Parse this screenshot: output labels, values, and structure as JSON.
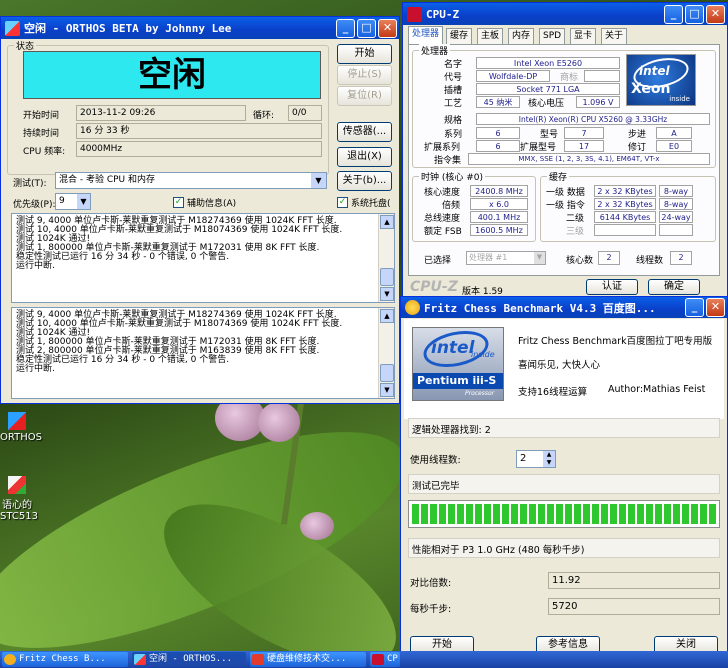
{
  "orthos": {
    "title": "空闲 - ORTHOS BETA by Johnny Lee",
    "status_group": "状态",
    "status_text": "空闲",
    "start_time_label": "开始时间",
    "start_time": "2013-11-2 09:26",
    "loop_label": "循环:",
    "loop": "0/0",
    "duration_label": "持续时间",
    "duration": "16 分 33 秒",
    "cpu_freq_label": "CPU 频率:",
    "cpu_freq": "4000MHz",
    "test_label": "测试(T):",
    "test_value": "混合 - 考验 CPU 和内存",
    "priority_label": "优先级(P):",
    "priority_value": "9",
    "aux_info": "辅助信息(A)",
    "systray": "系统托盘(",
    "buttons": {
      "start": "开始",
      "stop": "停止(S)",
      "reset": "复位(R)",
      "sensors": "传感器(...",
      "exit": "退出(X)",
      "about": "关于(b)..."
    },
    "log1": [
      "测试 9, 4000 单位卢卡斯-莱默重复测试于 M18274369 使用 1024K FFT 长度.",
      "测试 10, 4000 单位卢卡斯-莱默重复测试于 M18074369 使用 1024K FFT 长度.",
      "测试 1024K 通过!",
      "测试 1, 800000 单位卢卡斯-莱默重复测试于 M172031 使用 8K FFT 长度.",
      "稳定性测试已运行 16 分 34 秒 - 0 个错误, 0 个警告.",
      "运行中断."
    ],
    "log2": [
      "测试 9, 4000 单位卢卡斯-莱默重复测试于 M18274369 使用 1024K FFT 长度.",
      "测试 10, 4000 单位卢卡斯-莱默重复测试于 M18074369 使用 1024K FFT 长度.",
      "测试 1024K 通过!",
      "测试 1, 800000 单位卢卡斯-莱默重复测试于 M172031 使用 8K FFT 长度.",
      "测试 2, 800000 单位卢卡斯-莱默重复测试于 M163839 使用 8K FFT 长度.",
      "稳定性测试已运行 16 分 34 秒 - 0 个错误, 0 个警告.",
      "运行中断."
    ]
  },
  "cpuz": {
    "title": "CPU-Z",
    "tabs": [
      "处理器",
      "缓存",
      "主板",
      "内存",
      "SPD",
      "显卡",
      "关于"
    ],
    "processor_group": "处理器",
    "name_label": "名字",
    "name": "Intel Xeon E5260",
    "codename_label": "代号",
    "codename": "Wolfdale-DP",
    "brand_label": "商标",
    "package_label": "插槽",
    "package": "Socket 771 LGA",
    "tech_label": "工艺",
    "tech": "45 纳米",
    "voltage_label": "核心电压",
    "voltage": "1.096 V",
    "spec_label": "规格",
    "spec": "Intel(R) Xeon(R) CPU        X5260  @ 3.33GHz",
    "family_label": "系列",
    "family": "6",
    "model_label": "型号",
    "model": "7",
    "stepping_label": "步进",
    "stepping": "A",
    "ext_family_label": "扩展系列",
    "ext_family": "6",
    "ext_model_label": "扩展型号",
    "ext_model": "17",
    "revision_label": "修订",
    "revision": "E0",
    "instructions_label": "指令集",
    "instructions": "MMX, SSE (1, 2, 3, 3S, 4.1), EM64T, VT-x",
    "clocks_group": "时钟 (核心 #0)",
    "core_speed_label": "核心速度",
    "core_speed": "2400.8 MHz",
    "multiplier_label": "倍频",
    "multiplier": "x 6.0",
    "bus_speed_label": "总线速度",
    "bus_speed": "400.1 MHz",
    "rated_fsb_label": "额定 FSB",
    "rated_fsb": "1600.5 MHz",
    "cache_group": "缓存",
    "l1d_label": "一级 数据",
    "l1d": "2 x 32 KBytes",
    "l1d_way": "8-way",
    "l1i_label": "一级 指令",
    "l1i": "2 x 32 KBytes",
    "l1i_way": "8-way",
    "l2_label": "二级",
    "l2": "6144 KBytes",
    "l2_way": "24-way",
    "l3_label": "三级",
    "selection_label": "已选择",
    "selection": "处理器 #1",
    "cores_label": "核心数",
    "cores": "2",
    "threads_label": "线程数",
    "threads": "2",
    "logo": "CPU-Z",
    "version": "版本 1.59",
    "validate": "认证",
    "ok": "确定",
    "badge_brand": "intel",
    "badge_product": "Xeon",
    "badge_inside": "inside"
  },
  "fritz": {
    "title": "Fritz Chess Benchmark V4.3   百度图...",
    "badge_brand": "intel",
    "badge_inside": "inside",
    "badge_product": "Pentium iii-S",
    "badge_sub": "Processor",
    "line1": "Fritz Chess Benchmark百度图拉丁吧专用版",
    "line2": "喜闻乐见, 大快人心",
    "line3": "支持16线程运算",
    "author": "Author:Mathias Feist",
    "logical_found": "逻辑处理器找到: 2",
    "threads_label": "使用线程数:",
    "threads": "2",
    "status": "测试已完毕",
    "progress": 1.0,
    "perf_text": "性能相对于 P3 1.0 GHz (480 每秒千步)",
    "ratio_label": "对比倍数:",
    "ratio": "11.92",
    "kns_label": "每秒千步:",
    "kns": "5720",
    "buttons": {
      "start": "开始",
      "reference": "参考信息",
      "close": "关闭"
    }
  },
  "desktop": {
    "icon1": "ORTHOS",
    "icon2_l1": "语心的",
    "icon2_l2": "STC513"
  },
  "taskbar": {
    "items": [
      "Fritz Chess B...",
      "空闲 - ORTHOS...",
      "硬盘维修技术交...",
      "CP"
    ]
  }
}
